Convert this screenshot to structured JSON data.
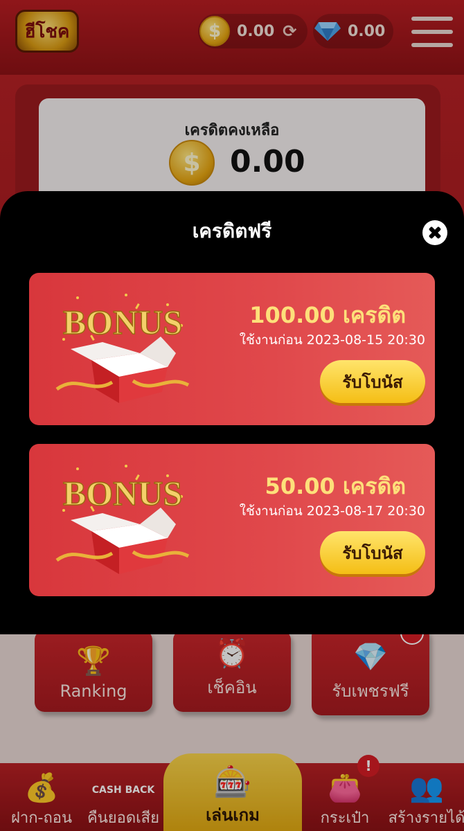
{
  "header": {
    "logo_text": "ฮีโชค",
    "coin_balance": "0.00",
    "diamond_balance": "0.00",
    "coin_symbol": "$"
  },
  "balance_card": {
    "label": "เครดิตคงเหลือ",
    "value": "0.00",
    "coin_symbol": "$"
  },
  "modal": {
    "title": "เครดิตฟรี",
    "bonuses": [
      {
        "art_text": "BONUS",
        "amount": "100.00 เครดิต",
        "expiry": "ใช้งานก่อน 2023-08-15 20:30",
        "button_label": "รับโบนัส"
      },
      {
        "art_text": "BONUS",
        "amount": "50.00 เครดิต",
        "expiry": "ใช้งานก่อน 2023-08-17 20:30",
        "button_label": "รับโบนัส"
      }
    ]
  },
  "tiles": {
    "ranking": "Ranking",
    "checkin": "เช็คอิน",
    "free_diamond": "รับเพชรฟรี"
  },
  "bottom_nav": {
    "deposit": "ฝาก-ถอน",
    "cashback": "คืนยอดเสีย",
    "cashback_icon_text": "CASH BACK",
    "play": "เล่นเกม",
    "wallet": "กระเป๋า",
    "affiliate": "สร้างรายได้",
    "wallet_badge": "!"
  },
  "colors": {
    "brand_red": "#b81d22",
    "card_red": "#d8373c",
    "gold_text": "#fde07a",
    "button_yellow": "#f4be15"
  }
}
